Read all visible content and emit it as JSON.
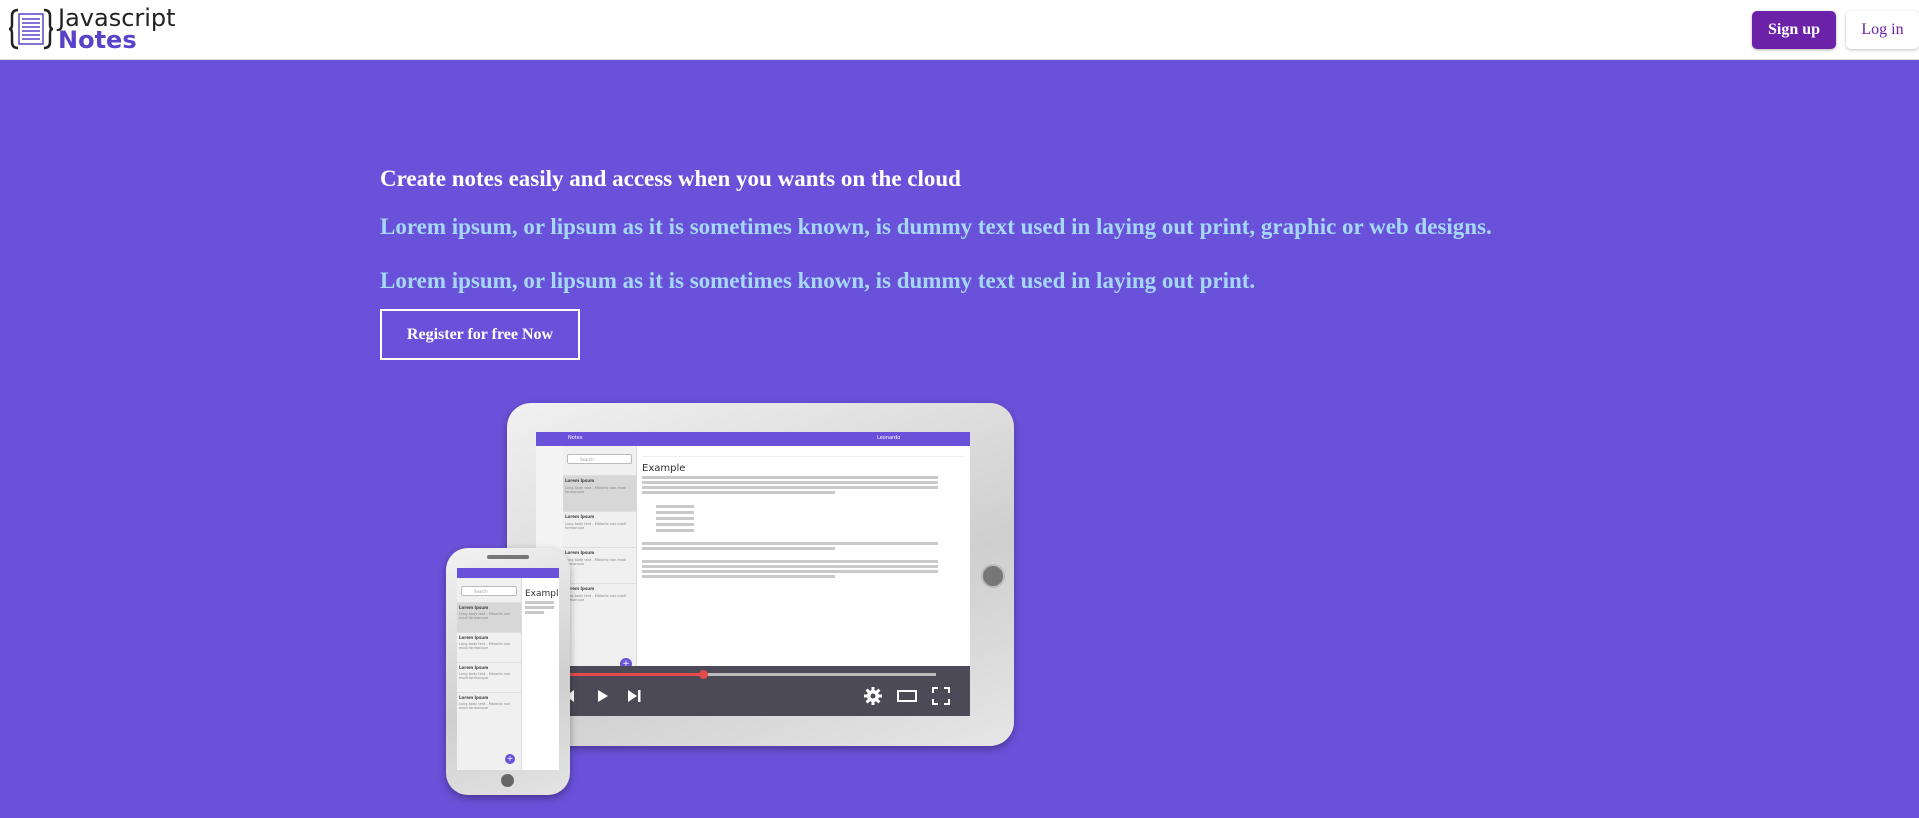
{
  "header": {
    "logo_line1": "Javascript",
    "logo_line2": "Notes",
    "signup_label": "Sign up",
    "login_label": "Log in"
  },
  "hero": {
    "title": "Create notes easily and access when you wants on the cloud",
    "lead1": "Lorem ipsum, or lipsum as it is sometimes known, is dummy text used in laying out print, graphic or web designs.",
    "lead2": "Lorem ipsum, or lipsum as it is sometimes known, is dummy text used in laying out print.",
    "register_label": "Register for free Now"
  },
  "mockup": {
    "editor_title": "Example",
    "note_title": "Lorem Ipsum",
    "note_body": "Long body text - Mbiarilo non modi formanque",
    "note_time": "10:30",
    "search_placeholder": "Search",
    "user_name": "Leonardo",
    "video_progress": 0.37
  },
  "colors": {
    "background": "#6a51d9",
    "accent": "#6b21a8",
    "lead_text": "#a5d8f5"
  }
}
